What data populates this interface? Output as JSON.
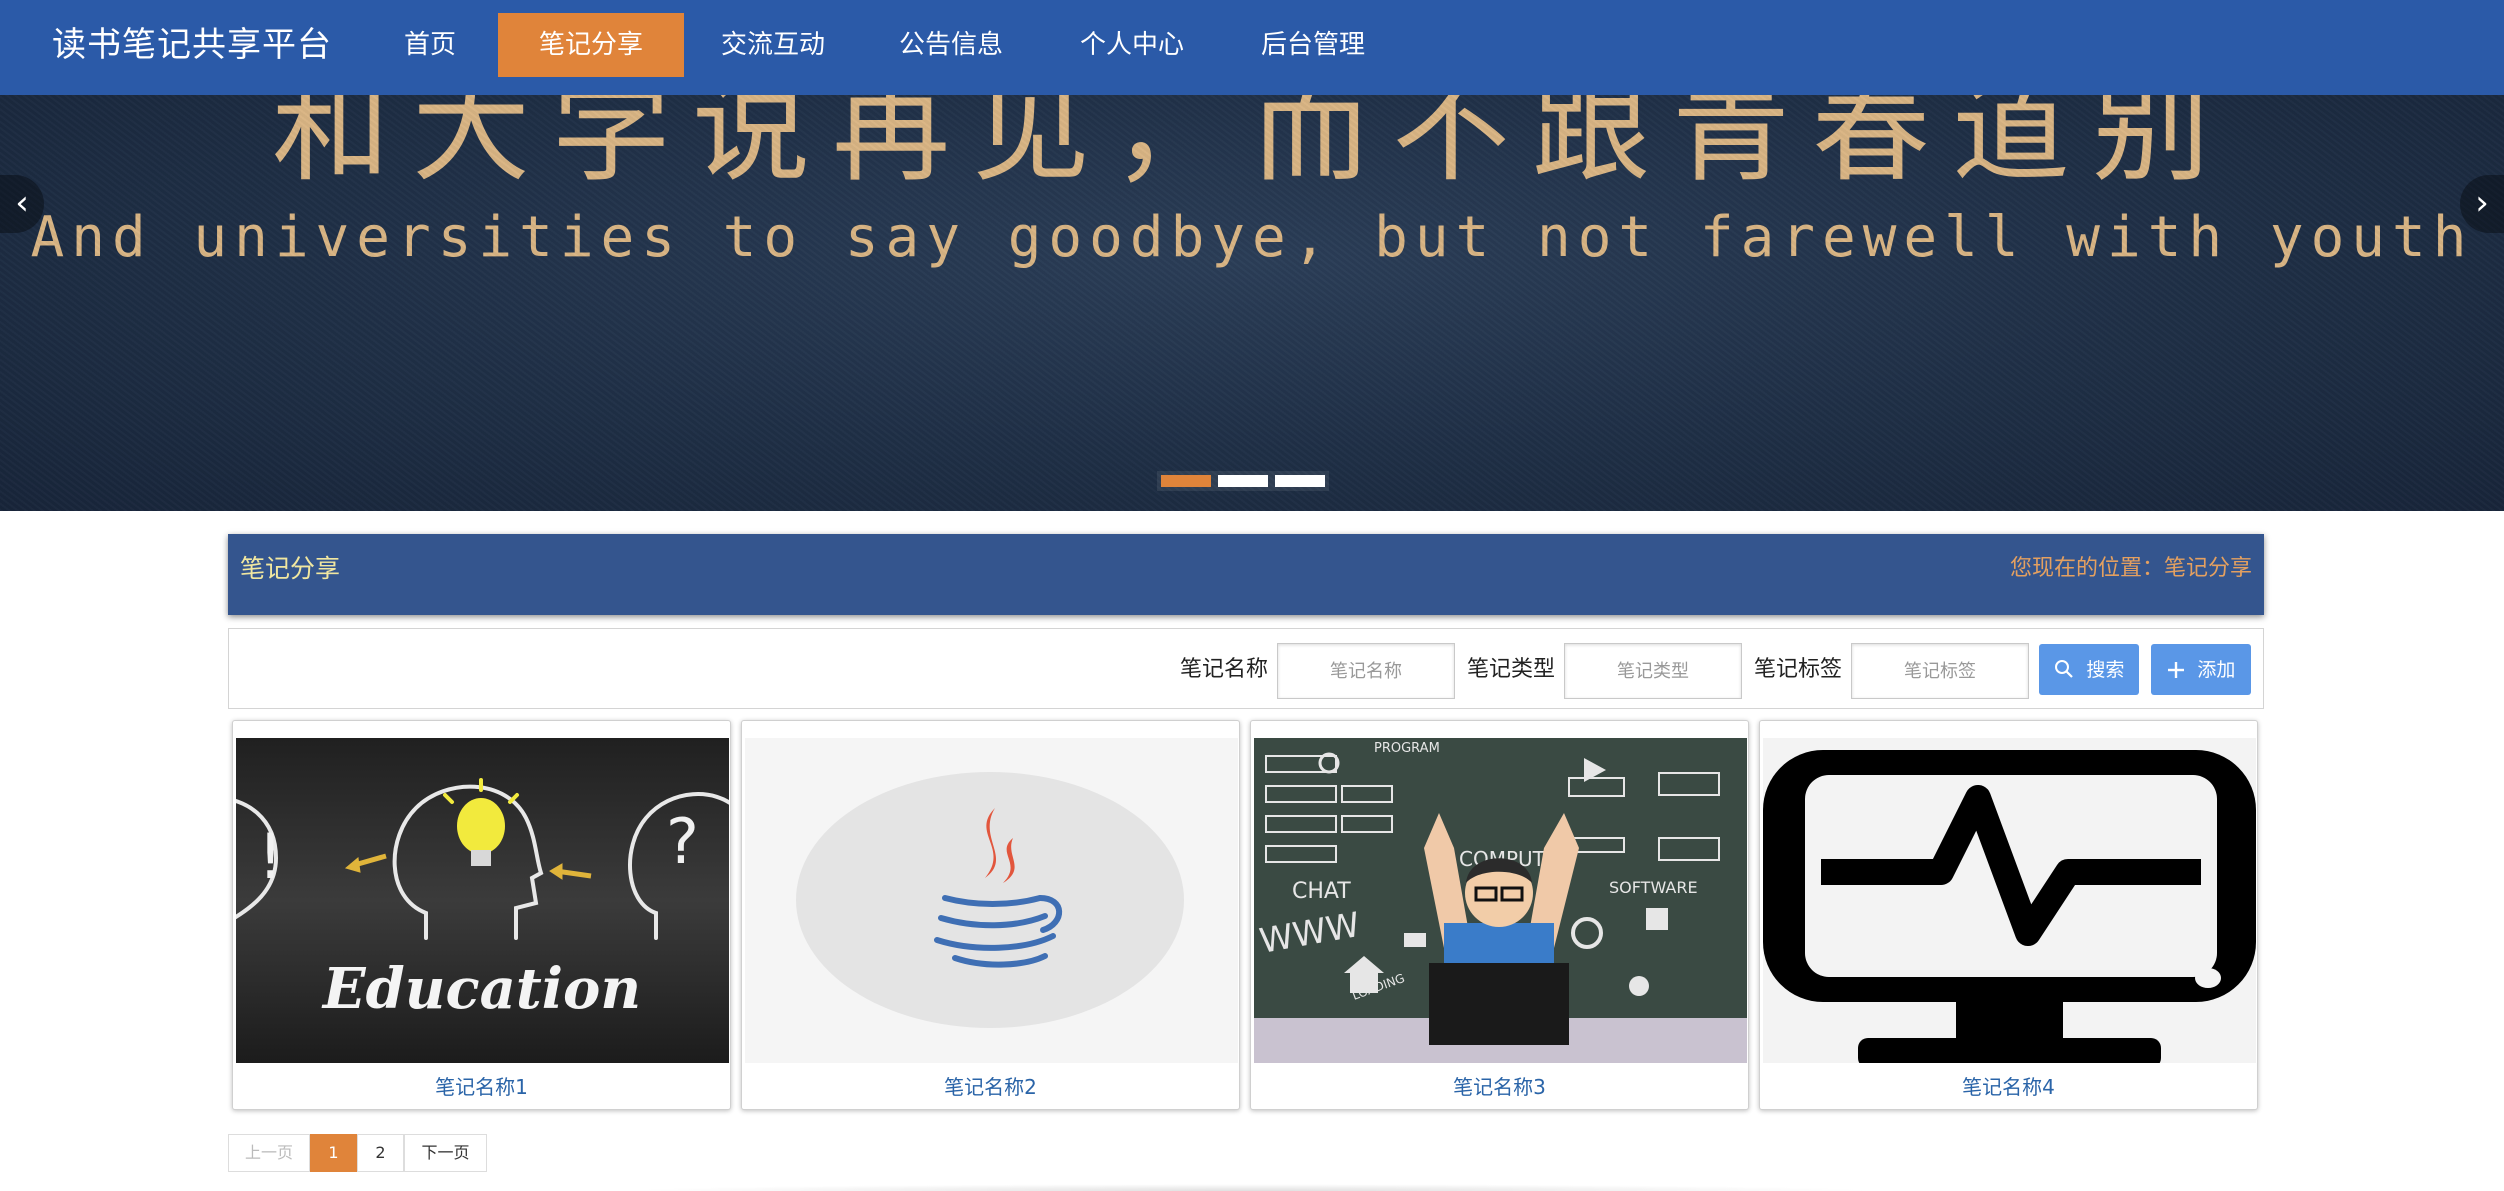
{
  "brand": "读书笔记共享平台",
  "nav": [
    "首页",
    "笔记分享",
    "交流互动",
    "公告信息",
    "个人中心",
    "后台管理"
  ],
  "nav_active_index": 1,
  "banner": {
    "text_cn": "和大学说再见，而不跟青春道别",
    "text_en": "And universities to say goodbye, but not farewell with youth",
    "prev_icon": "chevron-left-icon",
    "next_icon": "chevron-right-icon",
    "slide_count": 3,
    "active_slide": 1
  },
  "section": {
    "title": "笔记分享",
    "breadcrumb": "您现在的位置：笔记分享"
  },
  "search": {
    "name_label": "笔记名称",
    "name_placeholder": "笔记名称",
    "type_label": "笔记类型",
    "type_placeholder": "笔记类型",
    "tag_label": "笔记标签",
    "tag_placeholder": "笔记标签",
    "search_button": "搜索",
    "search_icon": "search-icon",
    "add_button": "添加",
    "add_icon": "plus-icon"
  },
  "notes": [
    {
      "name": "笔记名称1",
      "image": "education-chalkboard-image",
      "image_text": "Education"
    },
    {
      "name": "笔记名称2",
      "image": "java-logo-image"
    },
    {
      "name": "笔记名称3",
      "image": "computer-kid-chalkboard-image",
      "image_words": [
        "PROGRAM",
        "CHAT",
        "WWW",
        "COMPUTER",
        "SOFTWARE",
        "LOADING"
      ]
    },
    {
      "name": "笔记名称4",
      "image": "monitor-heartbeat-icon"
    }
  ],
  "pagination": {
    "prev": "上一页",
    "pages": [
      "1",
      "2"
    ],
    "current": "1",
    "next": "下一页"
  },
  "colors": {
    "nav_bg": "#2b5aa8",
    "accent_orange": "#e0843a",
    "section_header_bg": "#34558e",
    "button_blue": "#5a97e7",
    "link_blue": "#2a64a8"
  }
}
